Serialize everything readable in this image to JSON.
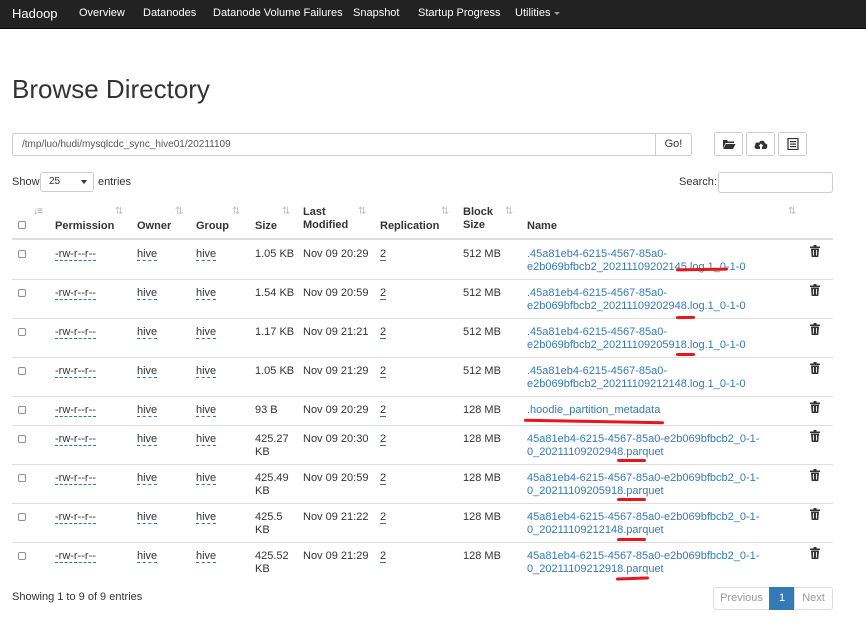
{
  "navbar": {
    "brand": "Hadoop",
    "items": [
      "Overview",
      "Datanodes",
      "Datanode Volume Failures",
      "Snapshot",
      "Startup Progress",
      "Utilities"
    ]
  },
  "page": {
    "title": "Browse Directory"
  },
  "path": {
    "value": "/tmp/luo/hudi/mysqlcdc_sync_hive01/20211109",
    "go_label": "Go!"
  },
  "toolbar": {
    "icons": [
      "folder-open-icon",
      "cloud-upload-icon",
      "list-alt-icon"
    ]
  },
  "table_controls": {
    "show_label": "Show",
    "page_size": "25",
    "entries_label": "entries",
    "search_label": "Search:",
    "search_value": ""
  },
  "columns": [
    "Permission",
    "Owner",
    "Group",
    "Size",
    "Last Modified",
    "Replication",
    "Block Size",
    "Name"
  ],
  "rows": [
    {
      "permission": "-rw-r--r--",
      "owner": "hive",
      "group": "hive",
      "size": [
        "1.05 KB"
      ],
      "modified": "Nov 09 20:29",
      "replication": "2",
      "block_size": "512 MB",
      "name": [
        ".45a81eb4-6215-4567-85a0-",
        "e2b069bfbcb2_20211109202145.log.1_0-1-0"
      ]
    },
    {
      "permission": "-rw-r--r--",
      "owner": "hive",
      "group": "hive",
      "size": [
        "1.54 KB"
      ],
      "modified": "Nov 09 20:59",
      "replication": "2",
      "block_size": "512 MB",
      "name": [
        ".45a81eb4-6215-4567-85a0-",
        "e2b069bfbcb2_20211109202948.log.1_0-1-0"
      ]
    },
    {
      "permission": "-rw-r--r--",
      "owner": "hive",
      "group": "hive",
      "size": [
        "1.17 KB"
      ],
      "modified": "Nov 09 21:21",
      "replication": "2",
      "block_size": "512 MB",
      "name": [
        ".45a81eb4-6215-4567-85a0-",
        "e2b069bfbcb2_20211109205918.log.1_0-1-0"
      ]
    },
    {
      "permission": "-rw-r--r--",
      "owner": "hive",
      "group": "hive",
      "size": [
        "1.05 KB"
      ],
      "modified": "Nov 09 21:29",
      "replication": "2",
      "block_size": "512 MB",
      "name": [
        ".45a81eb4-6215-4567-85a0-",
        "e2b069bfbcb2_20211109212148.log.1_0-1-0"
      ]
    },
    {
      "permission": "-rw-r--r--",
      "owner": "hive",
      "group": "hive",
      "size": [
        "93 B"
      ],
      "modified": "Nov 09 20:29",
      "replication": "2",
      "block_size": "128 MB",
      "name": [
        ".hoodie_partition_metadata"
      ]
    },
    {
      "permission": "-rw-r--r--",
      "owner": "hive",
      "group": "hive",
      "size": [
        "425.27",
        "KB"
      ],
      "modified": "Nov 09 20:30",
      "replication": "2",
      "block_size": "128 MB",
      "name": [
        "45a81eb4-6215-4567-85a0-e2b069bfbcb2_0-1-",
        "0_20211109202948.parquet"
      ]
    },
    {
      "permission": "-rw-r--r--",
      "owner": "hive",
      "group": "hive",
      "size": [
        "425.49",
        "KB"
      ],
      "modified": "Nov 09 20:59",
      "replication": "2",
      "block_size": "128 MB",
      "name": [
        "45a81eb4-6215-4567-85a0-e2b069bfbcb2_0-1-",
        "0_20211109205918.parquet"
      ]
    },
    {
      "permission": "-rw-r--r--",
      "owner": "hive",
      "group": "hive",
      "size": [
        "425.5",
        "KB"
      ],
      "modified": "Nov 09 21:22",
      "replication": "2",
      "block_size": "128 MB",
      "name": [
        "45a81eb4-6215-4567-85a0-e2b069bfbcb2_0-1-",
        "0_20211109212148.parquet"
      ]
    },
    {
      "permission": "-rw-r--r--",
      "owner": "hive",
      "group": "hive",
      "size": [
        "425.52",
        "KB"
      ],
      "modified": "Nov 09 21:29",
      "replication": "2",
      "block_size": "128 MB",
      "name": [
        "45a81eb4-6215-4567-85a0-e2b069bfbcb2_0-1-",
        "0_20211109212918.parquet"
      ]
    }
  ],
  "footer": {
    "info": "Showing 1 to 9 of 9 entries",
    "prev": "Previous",
    "current_page": "1",
    "next": "Next"
  },
  "colors": {
    "navbar": "#222222",
    "link": "#337ab7",
    "active_page": "#337ab7",
    "annotation_marks": "#e8161b"
  }
}
